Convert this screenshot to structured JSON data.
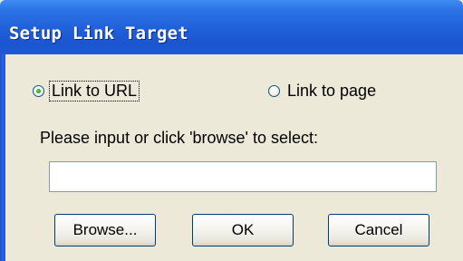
{
  "dialog": {
    "title": "Setup Link Target",
    "options": {
      "link_to_url": {
        "label": "Link to URL",
        "checked": true
      },
      "link_to_page": {
        "label": "Link to page",
        "checked": false
      }
    },
    "prompt": "Please input or click 'browse' to select:",
    "url_input": {
      "value": "",
      "placeholder": ""
    },
    "buttons": {
      "browse": "Browse...",
      "ok": "OK",
      "cancel": "Cancel"
    }
  }
}
